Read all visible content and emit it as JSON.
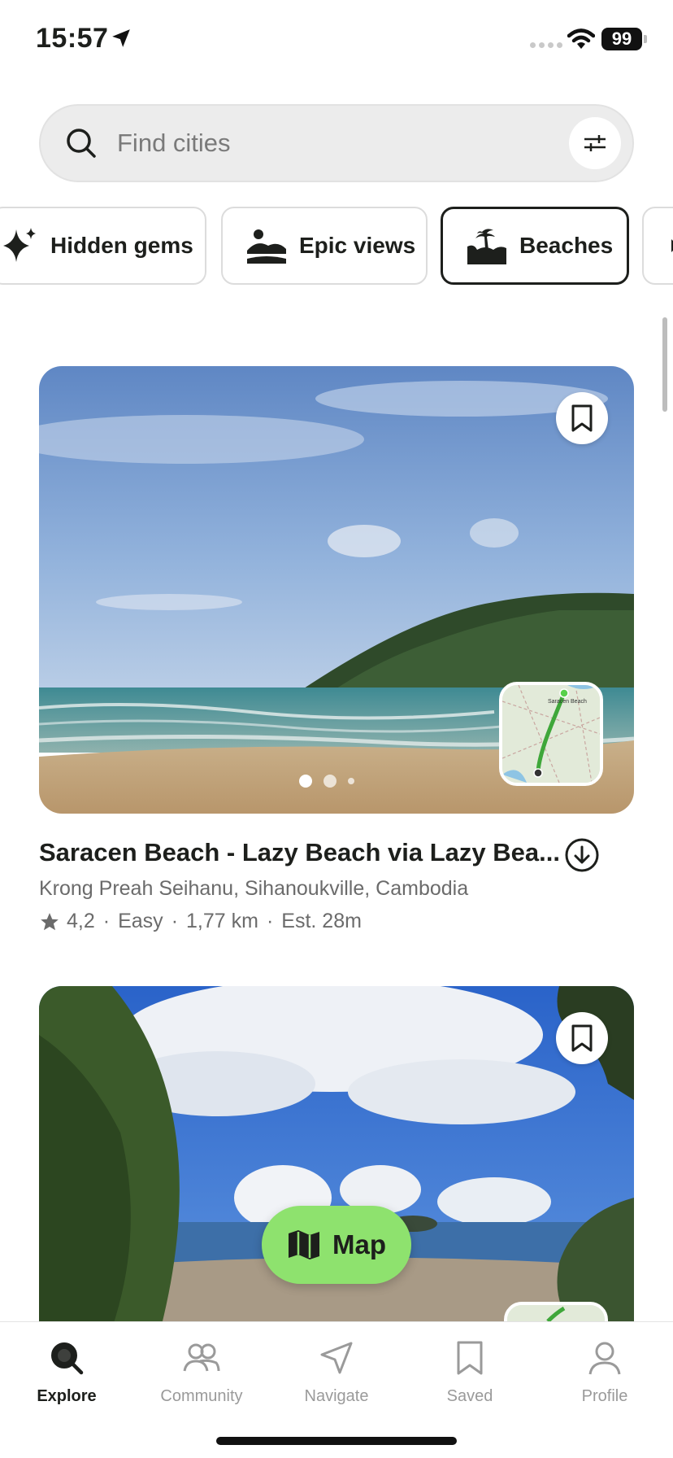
{
  "status_bar": {
    "time": "15:57",
    "battery": "99"
  },
  "search": {
    "placeholder": "Find cities"
  },
  "categories": [
    {
      "label": "Hidden gems",
      "icon": "sparkles-icon"
    },
    {
      "label": "Epic views",
      "icon": "mountain-view-icon"
    },
    {
      "label": "Beaches",
      "icon": "beach-icon",
      "selected": true
    }
  ],
  "trails": [
    {
      "title": "Saracen Beach - Lazy Beach via Lazy Bea...",
      "location": "Krong Preah Seihanu, Sihanoukville, Cambodia",
      "rating": "4,2",
      "difficulty": "Easy",
      "distance": "1,77 km",
      "duration": "Est. 28m",
      "photo_count": 3,
      "map_label": "Saracen Beach"
    },
    {
      "title": "",
      "photo_count": 1
    }
  ],
  "map_button": {
    "label": "Map"
  },
  "nav": [
    {
      "label": "Explore",
      "icon": "search-icon",
      "active": true
    },
    {
      "label": "Community",
      "icon": "community-icon"
    },
    {
      "label": "Navigate",
      "icon": "navigate-icon"
    },
    {
      "label": "Saved",
      "icon": "bookmark-icon"
    },
    {
      "label": "Profile",
      "icon": "profile-icon"
    }
  ],
  "colors": {
    "accent": "#8ee26e",
    "text": "#1d1f1c",
    "muted": "#6b6b6b"
  }
}
